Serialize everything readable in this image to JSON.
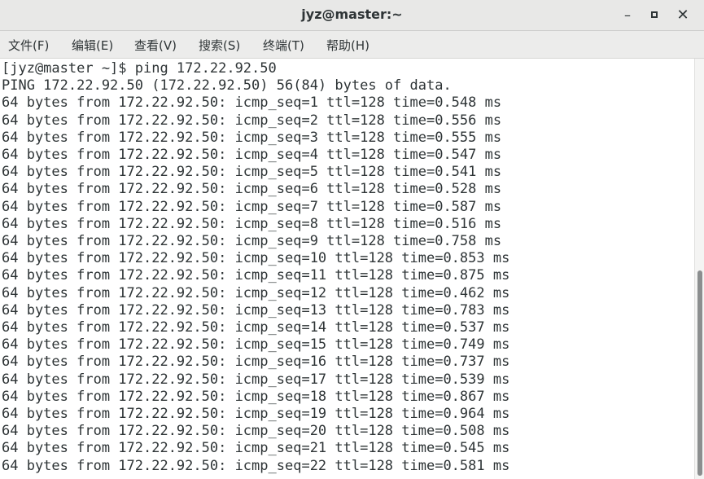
{
  "window": {
    "title": "jyz@master:~",
    "minimize_glyph": "–",
    "close_glyph": "✕"
  },
  "menu": {
    "items": [
      {
        "label": "文件(F)"
      },
      {
        "label": "编辑(E)"
      },
      {
        "label": "查看(V)"
      },
      {
        "label": "搜索(S)"
      },
      {
        "label": "终端(T)"
      },
      {
        "label": "帮助(H)"
      }
    ]
  },
  "terminal": {
    "lines": [
      "[jyz@master ~]$ ping 172.22.92.50",
      "PING 172.22.92.50 (172.22.92.50) 56(84) bytes of data.",
      "64 bytes from 172.22.92.50: icmp_seq=1 ttl=128 time=0.548 ms",
      "64 bytes from 172.22.92.50: icmp_seq=2 ttl=128 time=0.556 ms",
      "64 bytes from 172.22.92.50: icmp_seq=3 ttl=128 time=0.555 ms",
      "64 bytes from 172.22.92.50: icmp_seq=4 ttl=128 time=0.547 ms",
      "64 bytes from 172.22.92.50: icmp_seq=5 ttl=128 time=0.541 ms",
      "64 bytes from 172.22.92.50: icmp_seq=6 ttl=128 time=0.528 ms",
      "64 bytes from 172.22.92.50: icmp_seq=7 ttl=128 time=0.587 ms",
      "64 bytes from 172.22.92.50: icmp_seq=8 ttl=128 time=0.516 ms",
      "64 bytes from 172.22.92.50: icmp_seq=9 ttl=128 time=0.758 ms",
      "64 bytes from 172.22.92.50: icmp_seq=10 ttl=128 time=0.853 ms",
      "64 bytes from 172.22.92.50: icmp_seq=11 ttl=128 time=0.875 ms",
      "64 bytes from 172.22.92.50: icmp_seq=12 ttl=128 time=0.462 ms",
      "64 bytes from 172.22.92.50: icmp_seq=13 ttl=128 time=0.783 ms",
      "64 bytes from 172.22.92.50: icmp_seq=14 ttl=128 time=0.537 ms",
      "64 bytes from 172.22.92.50: icmp_seq=15 ttl=128 time=0.749 ms",
      "64 bytes from 172.22.92.50: icmp_seq=16 ttl=128 time=0.737 ms",
      "64 bytes from 172.22.92.50: icmp_seq=17 ttl=128 time=0.539 ms",
      "64 bytes from 172.22.92.50: icmp_seq=18 ttl=128 time=0.867 ms",
      "64 bytes from 172.22.92.50: icmp_seq=19 ttl=128 time=0.964 ms",
      "64 bytes from 172.22.92.50: icmp_seq=20 ttl=128 time=0.508 ms",
      "64 bytes from 172.22.92.50: icmp_seq=21 ttl=128 time=0.545 ms",
      "64 bytes from 172.22.92.50: icmp_seq=22 ttl=128 time=0.581 ms"
    ]
  },
  "colors": {
    "text": "#2e3436",
    "background": "#ffffff",
    "titlebar": "#e8e8e7",
    "scroll_thumb": "#8b8e8f"
  },
  "icons": {
    "minimize": "minimize-icon",
    "maximize": "maximize-icon",
    "close": "close-icon"
  }
}
